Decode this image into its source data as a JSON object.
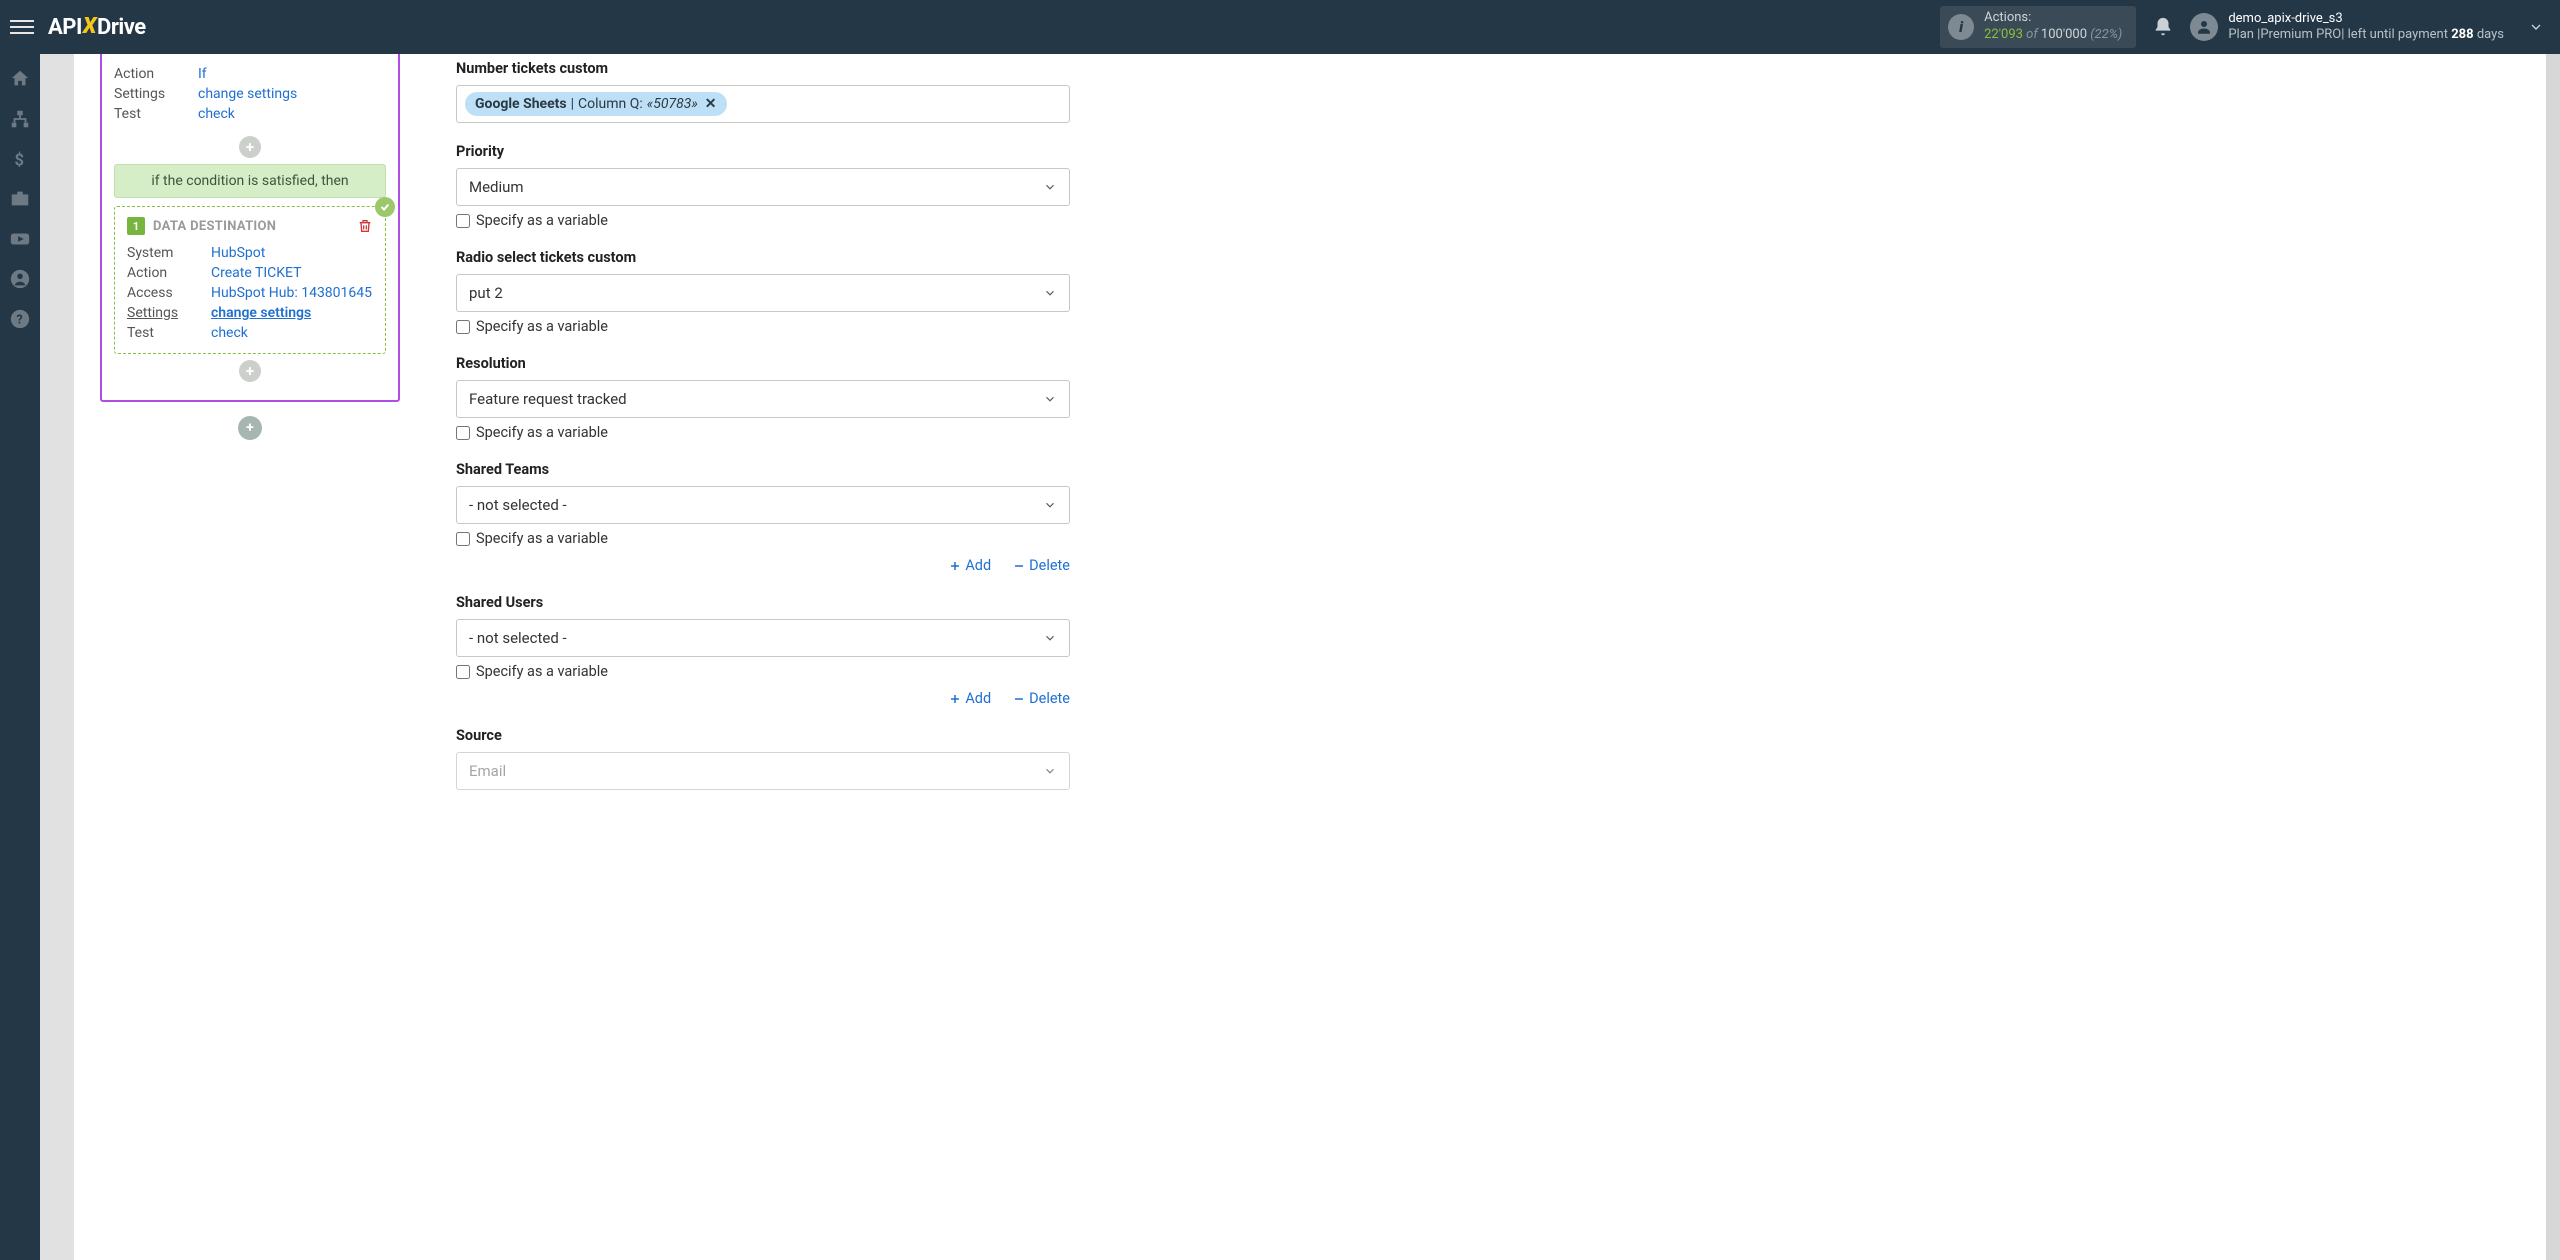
{
  "header": {
    "logo_pre": "API",
    "logo_x": "X",
    "logo_post": "Drive",
    "actions_label": "Actions:",
    "actions_used": "22'093",
    "actions_of": " of ",
    "actions_limit": "100'000",
    "actions_pct": " (22%)",
    "user_name": "demo_apix-drive_s3",
    "user_plan_prefix": "Plan |Premium PRO| left until payment ",
    "user_days": "288",
    "user_plan_suffix": " days"
  },
  "flow": {
    "top": {
      "action_k": "Action",
      "action_v": "If",
      "settings_k": "Settings",
      "settings_v": "change settings",
      "test_k": "Test",
      "test_v": "check"
    },
    "condition_text": "if the condition is satisfied, then",
    "dest": {
      "badge": "1",
      "title": "DATA DESTINATION",
      "rows": {
        "system_k": "System",
        "system_v": "HubSpot",
        "action_k": "Action",
        "action_v": "Create TICKET",
        "access_k": "Access",
        "access_v": "HubSpot Hub: 143801645",
        "settings_k": "Settings",
        "settings_v": "change settings",
        "test_k": "Test",
        "test_v": "check"
      }
    }
  },
  "form": {
    "specify_var": "Specify as a variable",
    "add": "Add",
    "delete": "Delete",
    "f1": {
      "label": "Number tickets custom",
      "chip_bold": "Google Sheets",
      "chip_sep": " | ",
      "chip_col": "Column Q: ",
      "chip_val": "«50783»"
    },
    "f2": {
      "label": "Priority",
      "value": "Medium"
    },
    "f3": {
      "label": "Radio select tickets custom",
      "value": "put 2"
    },
    "f4": {
      "label": "Resolution",
      "value": "Feature request tracked"
    },
    "f5": {
      "label": "Shared Teams",
      "value": "- not selected -"
    },
    "f6": {
      "label": "Shared Users",
      "value": "- not selected -"
    },
    "f7": {
      "label": "Source",
      "value": "Email"
    }
  }
}
